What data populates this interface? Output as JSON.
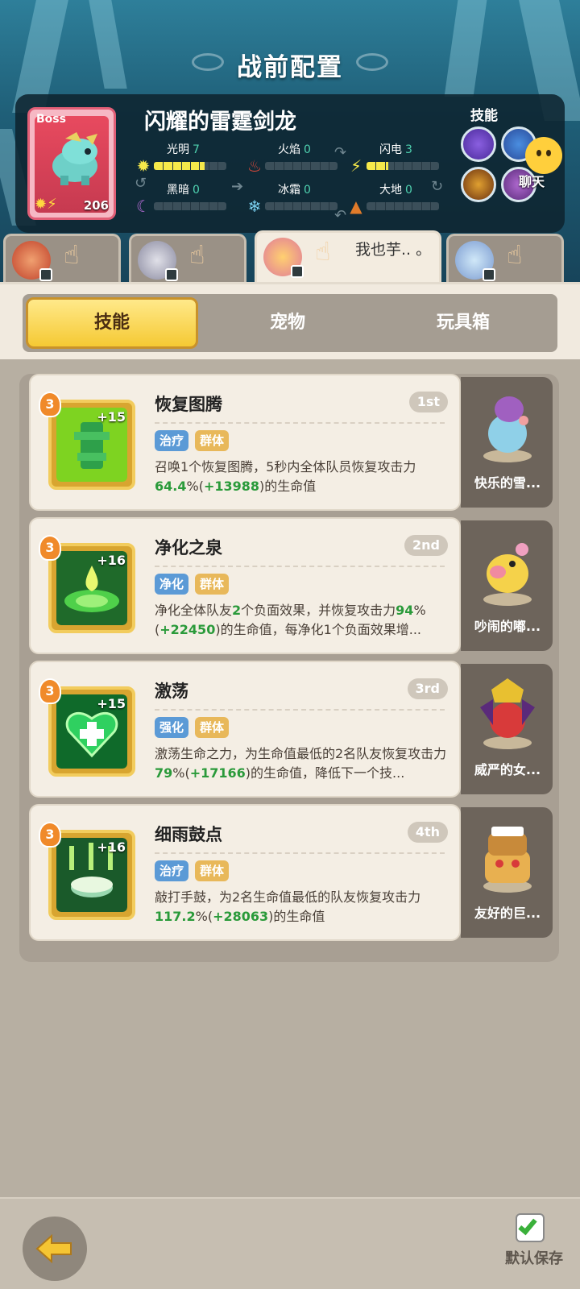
{
  "header": {
    "title": "战前配置"
  },
  "boss": {
    "tag": "Boss",
    "name": "闪耀的雷霆剑龙",
    "level": "206",
    "attributes": [
      {
        "label": "光明",
        "value": "7",
        "fill": 0.7,
        "color": "#f6e94a",
        "icon": "sun-icon"
      },
      {
        "label": "火焰",
        "value": "0",
        "fill": 0,
        "color": "#e24a3a",
        "icon": "fire-icon"
      },
      {
        "label": "闪电",
        "value": "3",
        "fill": 0.3,
        "color": "#f6e94a",
        "icon": "lightning-icon"
      },
      {
        "label": "黑暗",
        "value": "0",
        "fill": 0,
        "color": "#b46cd6",
        "icon": "moon-icon"
      },
      {
        "label": "冰霜",
        "value": "0",
        "fill": 0,
        "color": "#7ad0f0",
        "icon": "snowflake-icon"
      },
      {
        "label": "大地",
        "value": "0",
        "fill": 0,
        "color": "#e07b2a",
        "icon": "mountain-icon"
      }
    ],
    "skills_label": "技能"
  },
  "chat": {
    "label": "聊天"
  },
  "hero_tabs": [
    {
      "name": "hero-1",
      "active": false,
      "text": ""
    },
    {
      "name": "hero-2",
      "active": false,
      "text": ""
    },
    {
      "name": "hero-3",
      "active": true,
      "text": "我也芋.. 。"
    },
    {
      "name": "hero-4",
      "active": false,
      "text": ""
    }
  ],
  "category_tabs": [
    {
      "label": "技能",
      "active": true
    },
    {
      "label": "宠物",
      "active": false
    },
    {
      "label": "玩具箱",
      "active": false
    }
  ],
  "skills": [
    {
      "name": "恢复图腾",
      "order": "1st",
      "level": "3",
      "plus": "+15",
      "tags": [
        {
          "label": "治疗",
          "color": "blue"
        },
        {
          "label": "群体",
          "color": "gold"
        }
      ],
      "desc_parts": [
        {
          "t": "召唤1个恢复图腾，5秒内全体队员恢复攻击力"
        },
        {
          "t": "64.4",
          "hl": true
        },
        {
          "t": "%("
        },
        {
          "t": "+13988",
          "hl": true
        },
        {
          "t": ")的生命值"
        }
      ],
      "pet_name": "快乐的雪..."
    },
    {
      "name": "净化之泉",
      "order": "2nd",
      "level": "3",
      "plus": "+16",
      "tags": [
        {
          "label": "净化",
          "color": "blue"
        },
        {
          "label": "群体",
          "color": "gold"
        }
      ],
      "desc_parts": [
        {
          "t": "净化全体队友"
        },
        {
          "t": "2",
          "hl": true
        },
        {
          "t": "个负面效果，并恢复攻击力"
        },
        {
          "t": "94",
          "hl": true
        },
        {
          "t": "%("
        },
        {
          "t": "+22450",
          "hl": true
        },
        {
          "t": ")的生命值，每净化1个负面效果增..."
        }
      ],
      "pet_name": "吵闹的嘟..."
    },
    {
      "name": "激荡",
      "order": "3rd",
      "level": "3",
      "plus": "+15",
      "tags": [
        {
          "label": "强化",
          "color": "blue"
        },
        {
          "label": "群体",
          "color": "gold"
        }
      ],
      "desc_parts": [
        {
          "t": "激荡生命之力，为生命值最低的2名队友恢复攻击力"
        },
        {
          "t": "79",
          "hl": true
        },
        {
          "t": "%("
        },
        {
          "t": "+17166",
          "hl": true
        },
        {
          "t": ")的生命值，降低下一个技..."
        }
      ],
      "pet_name": "威严的女..."
    },
    {
      "name": "细雨鼓点",
      "order": "4th",
      "level": "3",
      "plus": "+16",
      "tags": [
        {
          "label": "治疗",
          "color": "blue"
        },
        {
          "label": "群体",
          "color": "gold"
        }
      ],
      "desc_parts": [
        {
          "t": "敲打手鼓，为2名生命值最低的队友恢复攻击力"
        },
        {
          "t": "117.2",
          "hl": true
        },
        {
          "t": "%("
        },
        {
          "t": "+28063",
          "hl": true
        },
        {
          "t": ")的生命值"
        }
      ],
      "pet_name": "友好的巨..."
    }
  ],
  "footer": {
    "save_label": "默认保存"
  }
}
